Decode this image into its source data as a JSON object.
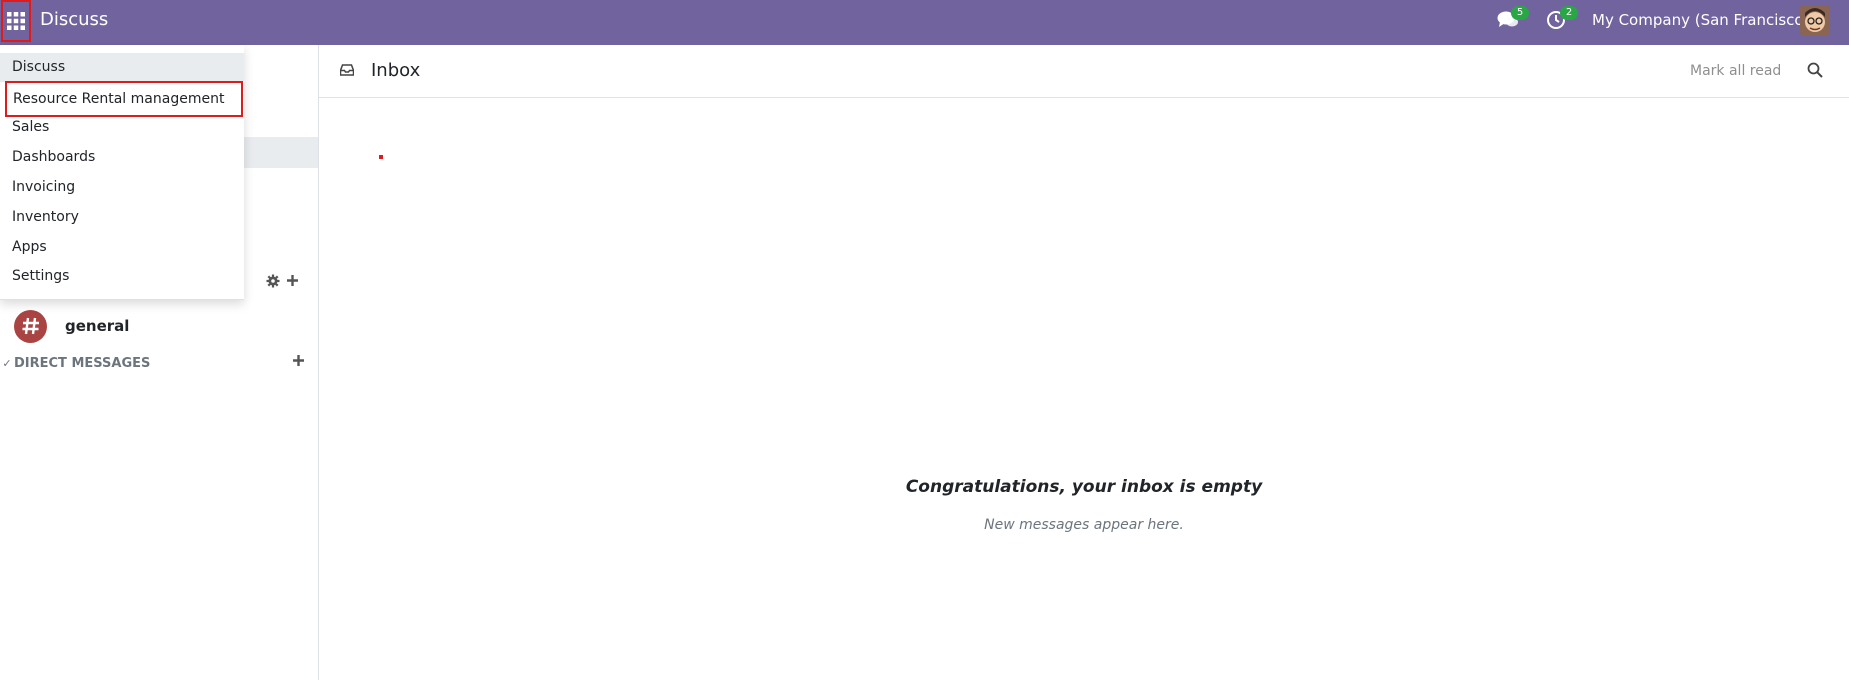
{
  "navbar": {
    "app_title": "Discuss",
    "messages_badge": "5",
    "activities_badge": "2",
    "company": "My Company (San Francisco)"
  },
  "app_menu": {
    "items": [
      {
        "label": "Discuss"
      },
      {
        "label": "Resource Rental management"
      },
      {
        "label": "Sales"
      },
      {
        "label": "Dashboards"
      },
      {
        "label": "Invoicing"
      },
      {
        "label": "Inventory"
      },
      {
        "label": "Apps"
      },
      {
        "label": "Settings"
      }
    ]
  },
  "sidebar": {
    "channel": {
      "name": "general"
    },
    "direct_messages": {
      "label": "DIRECT MESSAGES"
    }
  },
  "main": {
    "title": "Inbox",
    "mark_all_read": "Mark all read",
    "empty_title": "Congratulations, your inbox is empty",
    "empty_subtitle": "New messages appear here."
  },
  "colors": {
    "navbar": "#71639e",
    "badge": "#28a745",
    "highlight": "#e01b1b",
    "channel_avatar": "#a94442"
  }
}
